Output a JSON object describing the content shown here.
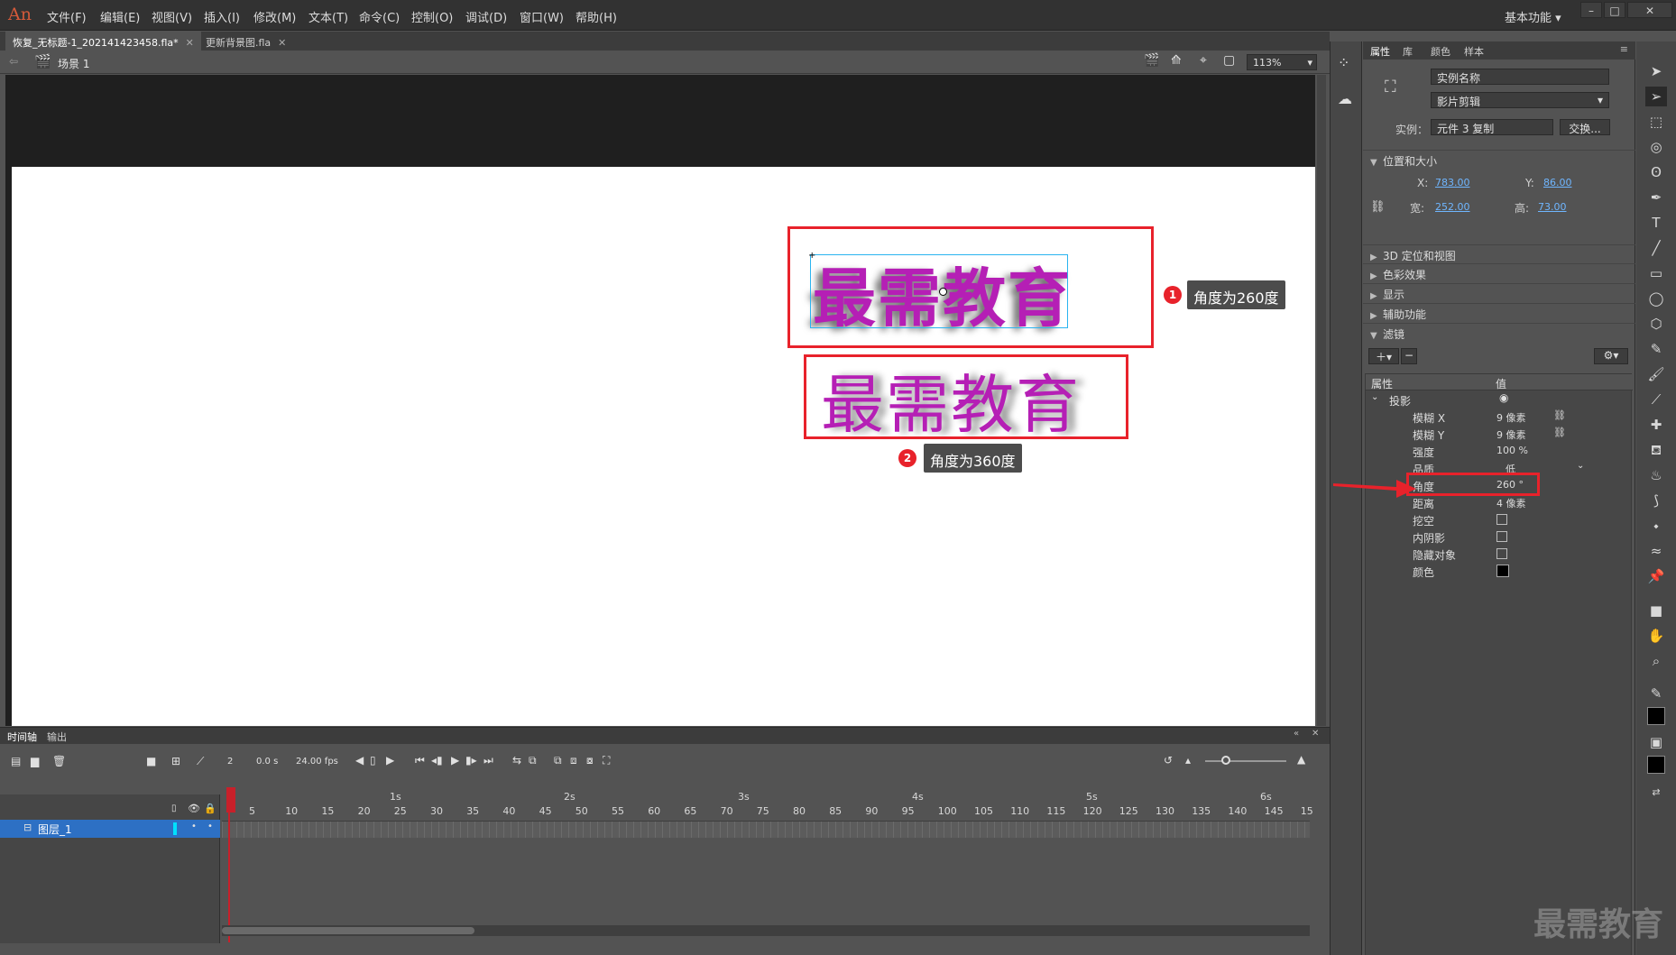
{
  "app": {
    "logo": "An",
    "workspace": "基本功能"
  },
  "menu": [
    "文件(F)",
    "编辑(E)",
    "视图(V)",
    "插入(I)",
    "修改(M)",
    "文本(T)",
    "命令(C)",
    "控制(O)",
    "调试(D)",
    "窗口(W)",
    "帮助(H)"
  ],
  "doc_tabs": [
    {
      "label": "恢复_无标题-1_202141423458.fla*",
      "active": true
    },
    {
      "label": "更新背景图.fla",
      "active": false
    }
  ],
  "editbar": {
    "scene": "场景 1",
    "zoom": "113%"
  },
  "stage": {
    "text1": "最需教育",
    "text2": "最需教育",
    "callout1": {
      "num": "1",
      "label": "角度为260度"
    },
    "callout2": {
      "num": "2",
      "label": "角度为360度"
    }
  },
  "timeline": {
    "tabs": [
      "时间轴",
      "输出"
    ],
    "current_frame": "2",
    "time": "0.0 s",
    "fps": "24.00 fps",
    "layer_name": "图层_1",
    "frame_ticks": [
      "5",
      "10",
      "15",
      "20",
      "25",
      "30",
      "35",
      "40",
      "45",
      "50",
      "55",
      "60",
      "65",
      "70",
      "75",
      "80",
      "85",
      "90",
      "95",
      "100",
      "105",
      "110",
      "115",
      "120",
      "125",
      "130",
      "135",
      "140",
      "145",
      "15"
    ],
    "second_marks": [
      "1s",
      "2s",
      "3s",
      "4s",
      "5s",
      "6s"
    ]
  },
  "props": {
    "tabs": [
      "属性",
      "库",
      "颜色",
      "样本"
    ],
    "instance_name_placeholder": "实例名称",
    "symbol_type": "影片剪辑",
    "instance_label": "实例：",
    "instance_of": "元件 3 复制",
    "swap_button": "交换...",
    "sections": {
      "pos_size": "位置和大小",
      "d3": "3D 定位和视图",
      "color_effect": "色彩效果",
      "display": "显示",
      "accessibility": "辅助功能",
      "filters": "滤镜"
    },
    "x_label": "X:",
    "x": "783.00",
    "y_label": "Y:",
    "y": "86.00",
    "w_label": "宽:",
    "w": "252.00",
    "h_label": "高:",
    "h": "73.00",
    "filter_header": {
      "prop": "属性",
      "value": "值"
    },
    "filter_name": "投影",
    "filter_rows": [
      {
        "name": "模糊 X",
        "value": "9 像素"
      },
      {
        "name": "模糊 Y",
        "value": "9 像素"
      },
      {
        "name": "强度",
        "value": "100 %"
      },
      {
        "name": "品质",
        "value": "低"
      },
      {
        "name": "角度",
        "value": "260 °"
      },
      {
        "name": "距离",
        "value": "4 像素"
      }
    ],
    "filter_checks": [
      "挖空",
      "内阴影",
      "隐藏对象"
    ],
    "color_label": "颜色"
  },
  "watermark": "最需教育",
  "colors": {
    "accent_red": "#e8222b",
    "text_magenta": "#b51fb5",
    "selection": "#2ab4f0"
  }
}
